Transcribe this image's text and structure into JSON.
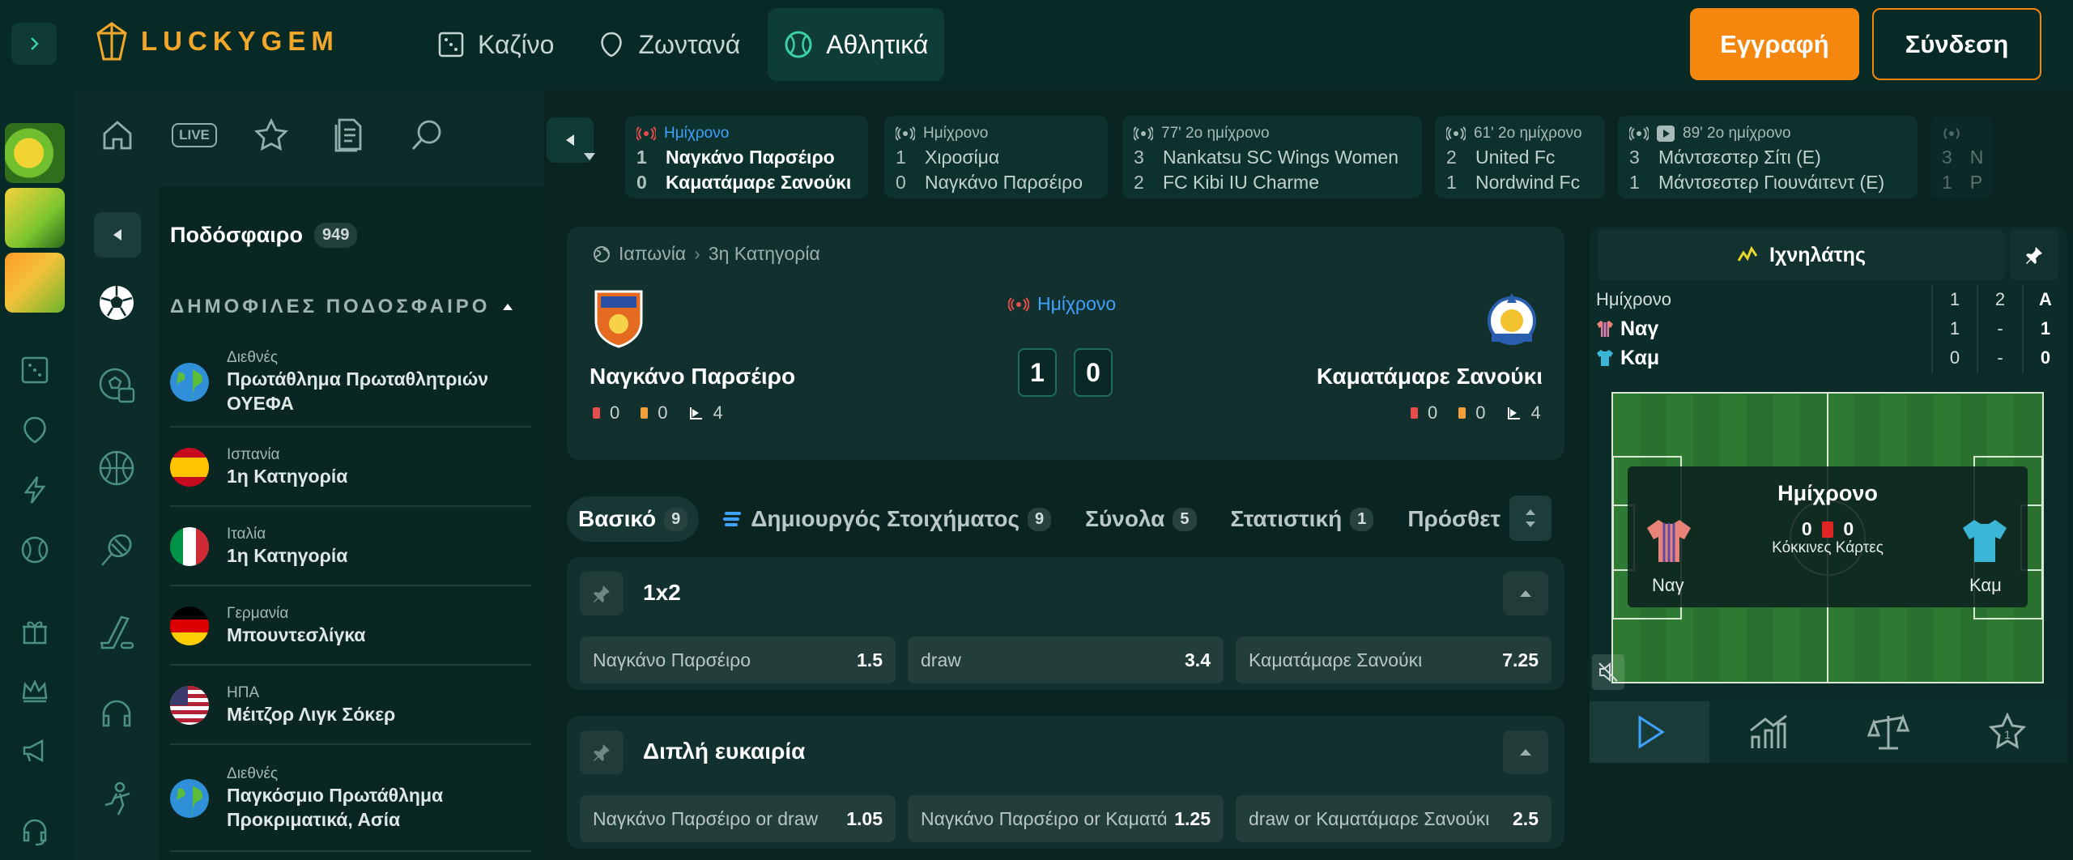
{
  "header": {
    "logo_text": "LUCKYGEM",
    "nav": [
      {
        "label": "Καζίνο",
        "icon": "dice-icon"
      },
      {
        "label": "Ζωντανά",
        "icon": "chip-icon"
      },
      {
        "label": "Αθλητικά",
        "icon": "tennis-ball-icon",
        "active": true
      }
    ],
    "register_label": "Εγγραφή",
    "login_label": "Σύνδεση"
  },
  "quickbar": {
    "live_label": "LIVE"
  },
  "sidebar": {
    "sport_title": "Ποδόσφαιρο",
    "sport_count": "949",
    "popular_label": "ΔΗΜΟΦΙΛΕΣ ΠΟΔΟΣΦΑΙΡΟ",
    "leagues": [
      {
        "country": "Διεθνές",
        "name": "Πρωτάθλημα Πρωταθλητριών ΟΥΕΦΑ",
        "flag": "globe"
      },
      {
        "country": "Ισπανία",
        "name": "1η Κατηγορία",
        "flag": "spain"
      },
      {
        "country": "Ιταλία",
        "name": "1η Κατηγορία",
        "flag": "italy"
      },
      {
        "country": "Γερμανία",
        "name": "Μπουντεσλίγκα",
        "flag": "germany"
      },
      {
        "country": "ΗΠΑ",
        "name": "Μέιτζορ Λιγκ Σόκερ",
        "flag": "usa"
      },
      {
        "country": "Διεθνές",
        "name": "Παγκόσμιο Πρωτάθλημα Προκριματικά, Ασία",
        "flag": "globe"
      }
    ]
  },
  "live_strip": [
    {
      "status": "Ημίχρονο",
      "highlight": true,
      "rows": [
        [
          "1",
          "Ναγκάνο Παρσέιρο"
        ],
        [
          "0",
          "Καματάμαρε Σανούκι"
        ]
      ]
    },
    {
      "status": "Ημίχρονο",
      "rows": [
        [
          "1",
          "Χιροσίμα"
        ],
        [
          "0",
          "Ναγκάνο Παρσέιρο"
        ]
      ]
    },
    {
      "status": "77' 2ο ημίχρονο",
      "rows": [
        [
          "3",
          "Nankatsu SC Wings Women"
        ],
        [
          "2",
          "FC Kibi IU Charme"
        ]
      ]
    },
    {
      "status": "61' 2ο ημίχρονο",
      "rows": [
        [
          "2",
          "United Fc"
        ],
        [
          "1",
          "Nordwind Fc"
        ]
      ]
    },
    {
      "status": "89' 2ο ημίχρονο",
      "rows": [
        [
          "3",
          "Μάντσεστερ Σίτι (Ε)"
        ],
        [
          "1",
          "Μάντσεστερ Γιουνάιτεντ (Ε)"
        ]
      ]
    },
    {
      "status": "",
      "rows": [
        [
          "3",
          "N"
        ],
        [
          "1",
          "P"
        ]
      ]
    }
  ],
  "match": {
    "country": "Ιαπωνία",
    "league": "3η Κατηγορία",
    "status": "Ημίχρονο",
    "home": "Ναγκάνο Παρσέιρο",
    "away": "Καματάμαρε Σανούκι",
    "home_score": "1",
    "away_score": "0",
    "home_stats": {
      "red": "0",
      "yellow": "0",
      "corners": "4"
    },
    "away_stats": {
      "red": "0",
      "yellow": "0",
      "corners": "4"
    }
  },
  "tabs": [
    {
      "label": "Βασικό",
      "count": "9",
      "active": true
    },
    {
      "label": "Δημιουργός Στοιχήματος",
      "count": "9"
    },
    {
      "label": "Σύνολα",
      "count": "5"
    },
    {
      "label": "Στατιστική",
      "count": "1"
    },
    {
      "label": "Πρόσθετ",
      "count": ""
    }
  ],
  "markets": [
    {
      "title": "1x2",
      "odds": [
        {
          "label": "Ναγκάνο Παρσέιρο",
          "value": "1.5"
        },
        {
          "label": "draw",
          "value": "3.4"
        },
        {
          "label": "Καματάμαρε Σανούκι",
          "value": "7.25"
        }
      ]
    },
    {
      "title": "Διπλή ευκαιρία",
      "odds": [
        {
          "label": "Ναγκάνο Παρσέιρο or draw",
          "value": "1.05"
        },
        {
          "label": "Ναγκάνο Παρσέιρο or Καματάμαρε Σανούκι",
          "value": "1.25"
        },
        {
          "label": "draw or Καματάμαρε Σανούκι",
          "value": "2.5"
        }
      ]
    }
  ],
  "tracker": {
    "title": "Ιχνηλάτης",
    "scoreboard": {
      "header": [
        "Ημίχρονο",
        "1",
        "2",
        "A"
      ],
      "rows": [
        {
          "team": "Ναγ",
          "cols": [
            "1",
            "-",
            "1"
          ]
        },
        {
          "team": "Καμ",
          "cols": [
            "0",
            "-",
            "0"
          ]
        }
      ]
    },
    "overlay_title": "Ημίχρονο",
    "overlay_home_cards": "0",
    "overlay_away_cards": "0",
    "overlay_label": "Κόκκινες Κάρτες",
    "home_short": "Ναγ",
    "away_short": "Καμ"
  },
  "colors": {
    "accent": "#f5870f",
    "live_blue": "#3fa2ff",
    "background": "#0a2422",
    "logo": "#f2a72b"
  }
}
